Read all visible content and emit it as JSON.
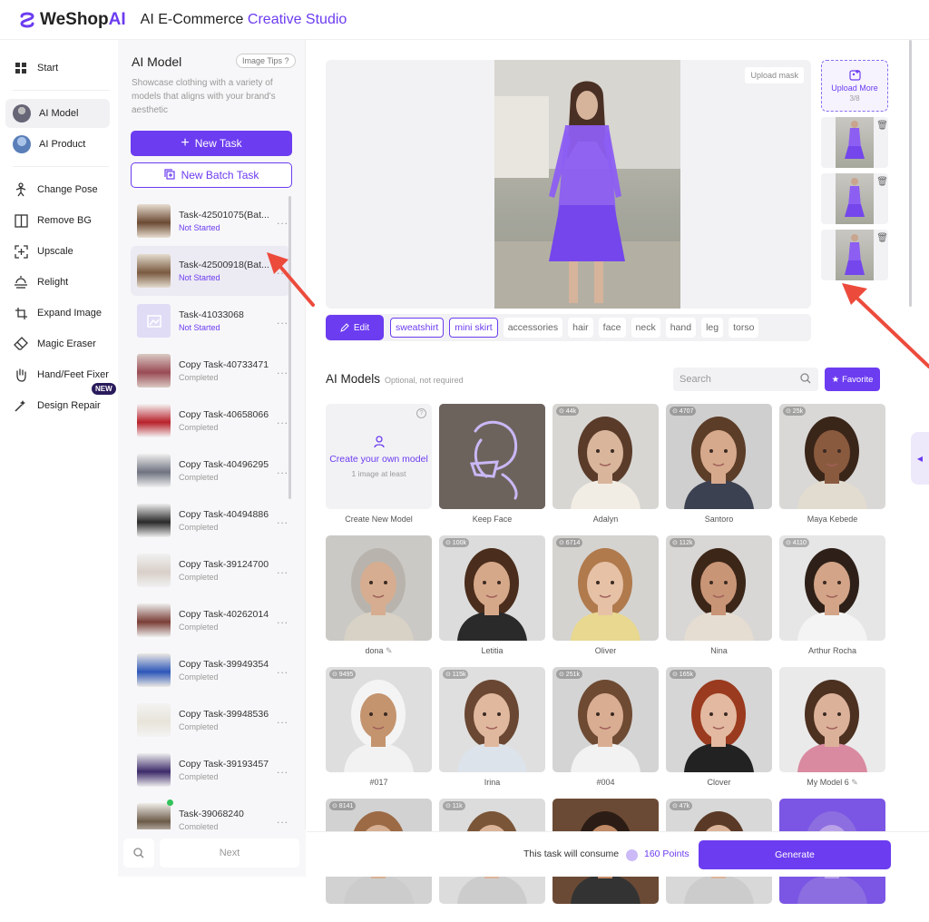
{
  "brand": {
    "name_part1": "WeShop",
    "name_part2": "AI",
    "app_title_plain": "AI E-Commerce ",
    "app_title_accent": "Creative Studio"
  },
  "nav": {
    "items": [
      {
        "label": "Start",
        "icon": "grid-icon"
      },
      {
        "label": "AI Model",
        "icon": "model-avatar",
        "active": true
      },
      {
        "label": "AI Product",
        "icon": "product-avatar"
      },
      {
        "label": "Change Pose",
        "icon": "pose-icon"
      },
      {
        "label": "Remove BG",
        "icon": "remove-bg-icon"
      },
      {
        "label": "Upscale",
        "icon": "upscale-icon"
      },
      {
        "label": "Relight",
        "icon": "relight-icon"
      },
      {
        "label": "Expand Image",
        "icon": "expand-icon"
      },
      {
        "label": "Magic Eraser",
        "icon": "eraser-icon"
      },
      {
        "label": "Hand/Feet Fixer",
        "icon": "hand-icon"
      },
      {
        "label": "Design Repair",
        "icon": "repair-icon",
        "badge": "NEW"
      }
    ]
  },
  "task_panel": {
    "title": "AI Model",
    "tips": "Image Tips",
    "description": "Showcase clothing with a variety of models that aligns with your brand's aesthetic",
    "new_task": "New Task",
    "new_batch_task": "New Batch Task",
    "tasks": [
      {
        "name": "Task-42501075(Bat...",
        "status": "Not Started",
        "state": "ns"
      },
      {
        "name": "Task-42500918(Bat...",
        "status": "Not Started",
        "state": "ns",
        "selected": true
      },
      {
        "name": "Task-41033068",
        "status": "Not Started",
        "state": "ns"
      },
      {
        "name": "Copy Task-40733471",
        "status": "Completed",
        "state": "c"
      },
      {
        "name": "Copy Task-40658066",
        "status": "Completed",
        "state": "c"
      },
      {
        "name": "Copy Task-40496295",
        "status": "Completed",
        "state": "c"
      },
      {
        "name": "Copy Task-40494886",
        "status": "Completed",
        "state": "c"
      },
      {
        "name": "Copy Task-39124700",
        "status": "Completed",
        "state": "c"
      },
      {
        "name": "Copy Task-40262014",
        "status": "Completed",
        "state": "c"
      },
      {
        "name": "Copy Task-39949354",
        "status": "Completed",
        "state": "c"
      },
      {
        "name": "Copy Task-39948536",
        "status": "Completed",
        "state": "c"
      },
      {
        "name": "Copy Task-39193457",
        "status": "Completed",
        "state": "c"
      },
      {
        "name": "Task-39068240",
        "status": "Completed",
        "state": "c"
      }
    ],
    "more": "...",
    "next": "Next"
  },
  "editor": {
    "upload_mask": "Upload mask",
    "upload_more": "Upload More",
    "upload_count": "3/8",
    "edit": "Edit",
    "tags": [
      {
        "label": "sweatshirt",
        "selected": true
      },
      {
        "label": "mini skirt",
        "selected": true
      },
      {
        "label": "accessories",
        "selected": false
      },
      {
        "label": "hair",
        "selected": false
      },
      {
        "label": "face",
        "selected": false
      },
      {
        "label": "neck",
        "selected": false
      },
      {
        "label": "hand",
        "selected": false
      },
      {
        "label": "leg",
        "selected": false
      },
      {
        "label": "torso",
        "selected": false
      }
    ]
  },
  "models": {
    "title": "AI Models",
    "subtitle": "Optional, not required",
    "search_placeholder": "Search",
    "favorite": "Favorite",
    "create_title": "Create your own model",
    "create_sub": "1 image at least",
    "cards": [
      {
        "label": "Create New Model",
        "kind": "create"
      },
      {
        "label": "Keep Face",
        "kind": "keepface"
      },
      {
        "label": "Adalyn",
        "uses": "44k",
        "skin": "#d9b59c",
        "hair": "#5a3b2a",
        "bg": "#d7d6d3",
        "top": "#f2ede4"
      },
      {
        "label": "Santoro",
        "uses": "4707",
        "skin": "#d7a98c",
        "hair": "#5c3d28",
        "bg": "#cfcfcf",
        "top": "#3b4150"
      },
      {
        "label": "Maya Kebede",
        "uses": "25k",
        "skin": "#8a5a3e",
        "hair": "#3a2519",
        "bg": "#d9d8d6",
        "top": "#e2dcd0"
      },
      {
        "label": "dona",
        "uses": "",
        "edit": true,
        "skin": "#d6ad90",
        "hair": "#b8b4ad",
        "bg": "#cbc9c5",
        "top": "#d8d2c6"
      },
      {
        "label": "Letitia",
        "uses": "100k",
        "skin": "#d6a88a",
        "hair": "#4a2d1c",
        "bg": "#dcdcdc",
        "top": "#2a2a2a"
      },
      {
        "label": "Oliver",
        "uses": "6714",
        "skin": "#e6c1a6",
        "hair": "#b07a4d",
        "bg": "#d4d3d0",
        "top": "#e8d890"
      },
      {
        "label": "Nina",
        "uses": "112k",
        "skin": "#c99577",
        "hair": "#3c2618",
        "bg": "#d8d7d5",
        "top": "#e5ddd2"
      },
      {
        "label": "Arthur Rocha",
        "uses": "4110",
        "skin": "#d3a488",
        "hair": "#2e2018",
        "bg": "#e6e6e6",
        "top": "#f4f4f4"
      },
      {
        "label": "#017",
        "uses": "9495",
        "skin": "#c4946f",
        "hair": "#f4f4f4",
        "bg": "#dedede",
        "top": "#f2f2f2"
      },
      {
        "label": "Irina",
        "uses": "115k",
        "skin": "#e0b89e",
        "hair": "#6a4733",
        "bg": "#dfdfdf",
        "top": "#dde3ea"
      },
      {
        "label": "#004",
        "uses": "251k",
        "skin": "#d9ad92",
        "hair": "#6e4a33",
        "bg": "#d4d4d4",
        "top": "#f2f2f2"
      },
      {
        "label": "Clover",
        "uses": "165k",
        "skin": "#e3b9a1",
        "hair": "#9a3a1e",
        "bg": "#d6d6d6",
        "top": "#222"
      },
      {
        "label": "My Model 6",
        "uses": "",
        "edit": true,
        "skin": "#dcb19a",
        "hair": "#4c3020",
        "bg": "#eaeaea",
        "top": "#d98aa0"
      },
      {
        "label": "",
        "uses": "8141",
        "skin": "#d7b093",
        "hair": "#9c6a45",
        "bg": "#d2d2d2",
        "top": "#ccc"
      },
      {
        "label": "",
        "uses": "11k",
        "skin": "#dcb49a",
        "hair": "#7a5537",
        "bg": "#dcdcdc",
        "top": "#ccc"
      },
      {
        "label": "",
        "uses": "",
        "skin": "#c08a66",
        "hair": "#2b1d15",
        "bg": "#6b4a35",
        "top": "#333"
      },
      {
        "label": "",
        "uses": "47k",
        "skin": "#dcb49a",
        "hair": "#5a3a26",
        "bg": "#d8d8d8",
        "top": "#ccc"
      },
      {
        "label": "",
        "uses": "",
        "skin": "#b9a2e8",
        "hair": "#8c6ee0",
        "bg": "#7b56e4",
        "top": "#8c6ee0"
      }
    ]
  },
  "footer": {
    "consume_text": "This task will consume",
    "points": "160 Points",
    "generate": "Generate"
  },
  "colors": {
    "accent": "#6c3cf0",
    "arrow": "#ec4b3c"
  }
}
